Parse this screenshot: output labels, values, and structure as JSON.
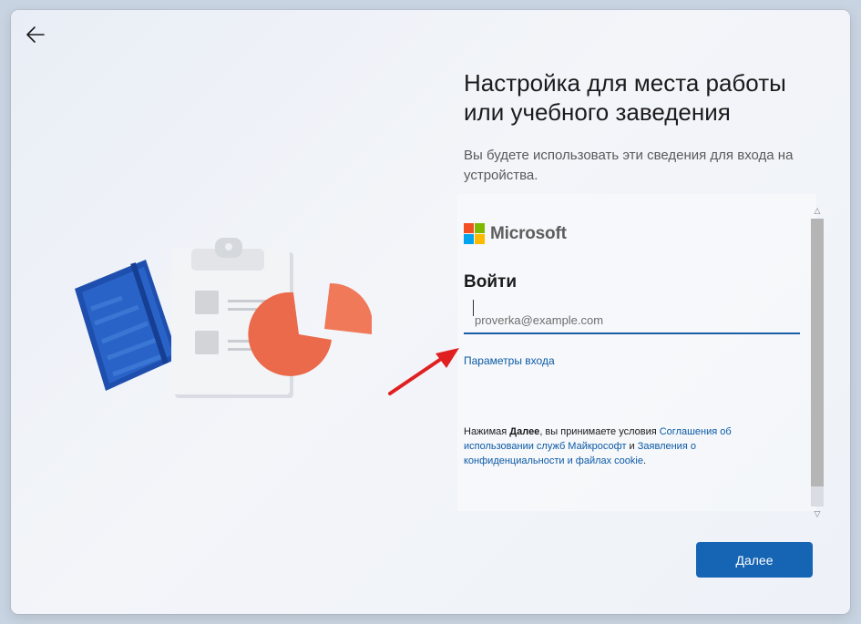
{
  "page": {
    "title": "Настройка для места работы или учебного заведения",
    "subtitle": "Вы будете использовать эти сведения для входа на устройства."
  },
  "signin": {
    "brand": "Microsoft",
    "heading": "Войти",
    "email_placeholder": "proverka@example.com",
    "options_link": "Параметры входа"
  },
  "terms": {
    "prefix": "Нажимая ",
    "bold": "Далее",
    "middle": ", вы принимаете условия ",
    "link1": "Соглашения об использовании служб Майкрософт",
    "and": " и ",
    "link2": "Заявления о конфиденциальности и файлах cookie",
    "end": "."
  },
  "buttons": {
    "next": "Далее"
  },
  "colors": {
    "accent": "#1565b4",
    "link": "#0c5aa6",
    "annotation_arrow": "#e02020",
    "ms_red": "#f25022",
    "ms_green": "#7fba00",
    "ms_blue": "#00a4ef",
    "ms_yellow": "#ffb900"
  },
  "icons": {
    "back": "arrow-left-icon",
    "scroll_up": "chevron-up-icon",
    "scroll_down": "chevron-down-icon"
  }
}
